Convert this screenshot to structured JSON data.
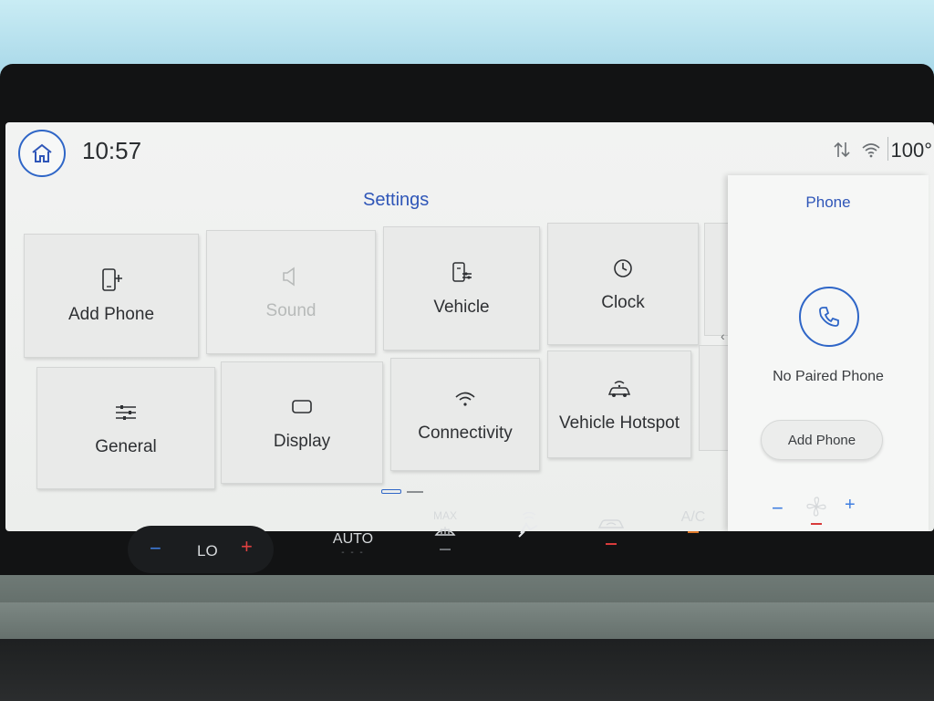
{
  "status_bar": {
    "time": "10:57",
    "temperature": "100°",
    "icons": [
      "home-icon",
      "data-arrows-icon",
      "wifi-icon"
    ]
  },
  "settings": {
    "title": "Settings",
    "tiles": [
      {
        "label": "Add Phone",
        "icon": "phone-add-icon",
        "enabled": true
      },
      {
        "label": "Sound",
        "icon": "speaker-icon",
        "enabled": false
      },
      {
        "label": "Vehicle",
        "icon": "vehicle-settings-icon",
        "enabled": true
      },
      {
        "label": "Clock",
        "icon": "clock-icon",
        "enabled": true
      },
      {
        "label": "General",
        "icon": "sliders-icon",
        "enabled": true
      },
      {
        "label": "Display",
        "icon": "display-icon",
        "enabled": true
      },
      {
        "label": "Connectivity",
        "icon": "wifi-icon",
        "enabled": true
      },
      {
        "label": "Vehicle Hotspot",
        "icon": "car-wifi-icon",
        "enabled": true
      }
    ],
    "scroll_arrow": "‹"
  },
  "phone_panel": {
    "title": "Phone",
    "status": "No Paired Phone",
    "add_button": "Add Phone"
  },
  "climate": {
    "temp_label": "LO",
    "minus": "−",
    "plus": "+",
    "auto_label": "AUTO",
    "auto_dashes": "- - -",
    "max_label": "MAX",
    "ac_label": "A/C",
    "fan_minus": "−",
    "fan_plus": "+"
  },
  "colors": {
    "accent_blue": "#2f56b8",
    "ring_blue": "#2f66c7",
    "indicator_red": "#d83b3b",
    "indicator_orange": "#e07a2b"
  }
}
